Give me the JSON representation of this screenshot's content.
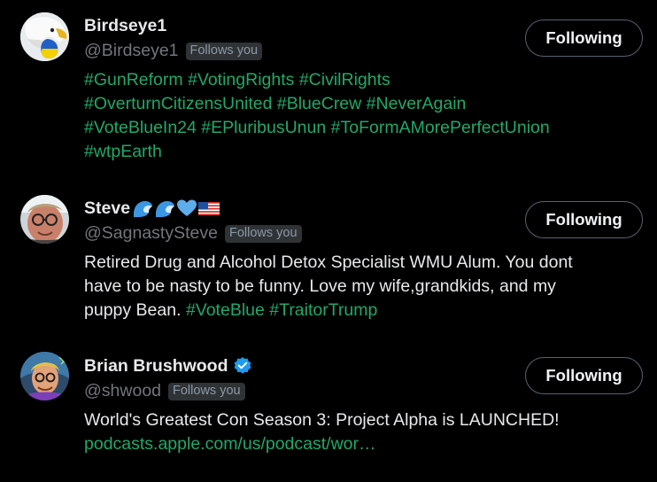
{
  "users": [
    {
      "display_name": "Birdseye1",
      "handle": "@Birdseye1",
      "follows_you": "Follows you",
      "button": "Following",
      "bio_parts": [
        {
          "t": "tag",
          "v": "#GunReform"
        },
        {
          "t": "sp",
          "v": " "
        },
        {
          "t": "tag",
          "v": "#VotingRights"
        },
        {
          "t": "sp",
          "v": " "
        },
        {
          "t": "tag",
          "v": "#CivilRights"
        },
        {
          "t": "br"
        },
        {
          "t": "tag",
          "v": "#OverturnCitizensUnited"
        },
        {
          "t": "sp",
          "v": " "
        },
        {
          "t": "tag",
          "v": "#BlueCrew"
        },
        {
          "t": "sp",
          "v": " "
        },
        {
          "t": "tag",
          "v": "#NeverAgain"
        },
        {
          "t": "br"
        },
        {
          "t": "tag",
          "v": "#VoteBlueIn24"
        },
        {
          "t": "sp",
          "v": " "
        },
        {
          "t": "tag",
          "v": "#EPluribusUnun"
        },
        {
          "t": "sp",
          "v": " "
        },
        {
          "t": "tag",
          "v": "#ToFormAMorePerfectUnion"
        },
        {
          "t": "br"
        },
        {
          "t": "tag",
          "v": "#wtpEarth"
        }
      ]
    },
    {
      "display_name": "Steve",
      "name_emojis": [
        "wave-emoji",
        "wave-emoji",
        "blue-heart-emoji",
        "us-flag-emoji"
      ],
      "handle": "@SagnastySteve",
      "follows_you": "Follows you",
      "button": "Following",
      "bio_parts": [
        {
          "t": "text",
          "v": "Retired Drug and Alcohol Detox Specialist WMU Alum. You dont"
        },
        {
          "t": "br"
        },
        {
          "t": "text",
          "v": "have to be nasty to be funny. Love my wife,grandkids, and my"
        },
        {
          "t": "br"
        },
        {
          "t": "text",
          "v": "puppy Bean. "
        },
        {
          "t": "tag",
          "v": "#VoteBlue"
        },
        {
          "t": "sp",
          "v": " "
        },
        {
          "t": "tag",
          "v": "#TraitorTrump"
        }
      ]
    },
    {
      "display_name": "Brian Brushwood",
      "verified_icon": "verified-badge-icon",
      "handle": "@shwood",
      "follows_you": "Follows you",
      "button": "Following",
      "bio_parts": [
        {
          "t": "text",
          "v": "World's Greatest Con Season 3: Project Alpha is LAUNCHED!"
        },
        {
          "t": "br"
        },
        {
          "t": "link",
          "v": "podcasts.apple.com/us/podcast/wor…"
        }
      ]
    }
  ],
  "colors": {
    "background": "#000000",
    "primary_text": "#e7e9ea",
    "secondary_text": "#71767b",
    "hashtag": "#1fa96a",
    "badge_bg": "#2f3336",
    "button_border": "#536471",
    "verified": "#1d9bf0"
  }
}
